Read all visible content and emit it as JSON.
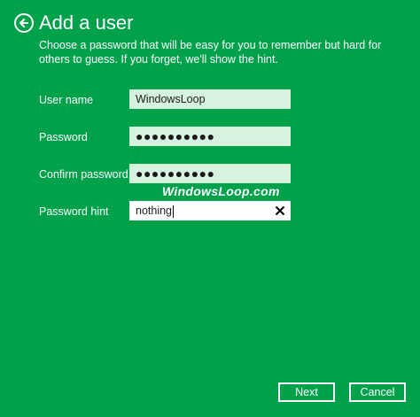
{
  "header": {
    "back_icon": "arrow-left-circle-icon",
    "title": "Add a user"
  },
  "description": "Choose a password that will be easy for you to remember but hard for others to guess. If you forget, we'll show the hint.",
  "form": {
    "username": {
      "label": "User name",
      "value": "WindowsLoop"
    },
    "password": {
      "label": "Password",
      "value": "●●●●●●●●●●"
    },
    "confirm_password": {
      "label": "Confirm password",
      "value": "●●●●●●●●●●"
    },
    "password_hint": {
      "label": "Password hint",
      "value": "nothing",
      "clear_icon": "close-icon"
    }
  },
  "watermark": "WindowsLoop.com",
  "buttons": {
    "next": "Next",
    "cancel": "Cancel"
  },
  "colors": {
    "background": "#00a14b",
    "field_inactive": "#d6f3e0",
    "field_active": "#ffffff",
    "text": "#ffffff"
  }
}
